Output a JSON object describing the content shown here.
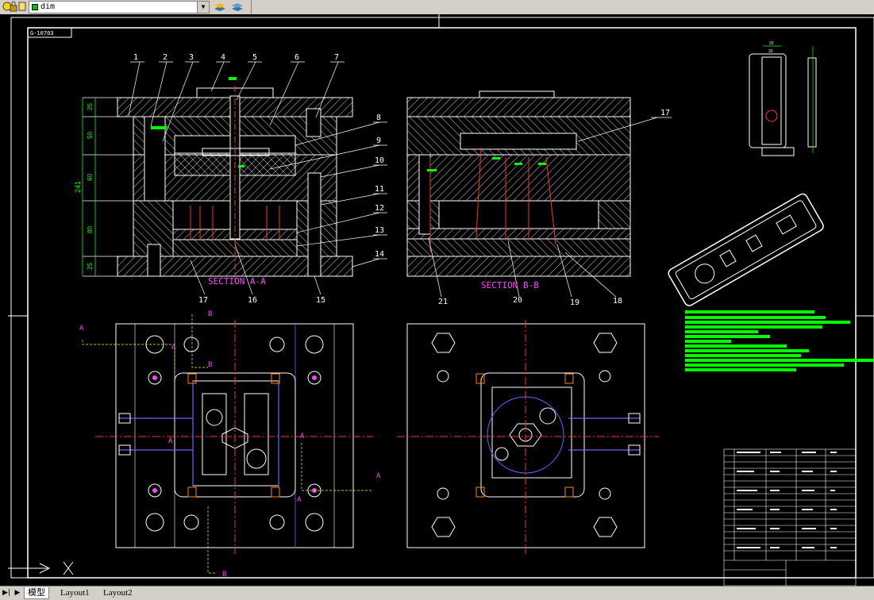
{
  "toolbar": {
    "layer_name": "dim",
    "layer_color": "#00c000",
    "icons": [
      "layer-state-icon",
      "layer-lock-icon",
      "layer-freeze-icon",
      "layer-color-icon",
      "layer-previous-icon",
      "layer-manager-icon"
    ]
  },
  "drawing": {
    "title_block_text": "G-10703",
    "dimensions": [
      "25",
      "50",
      "60",
      "80",
      "25",
      "241"
    ],
    "top_view_dims": [
      "22",
      "32"
    ],
    "part_numbers_left": [
      "1",
      "2",
      "3",
      "4",
      "5",
      "6",
      "7"
    ],
    "part_numbers_right": [
      "8",
      "9",
      "10",
      "11",
      "12",
      "13",
      "14"
    ],
    "part_numbers_bottom_left": [
      "17",
      "16",
      "15"
    ],
    "part_numbers_b": [
      "17"
    ],
    "part_numbers_bottom_right": [
      "21",
      "20",
      "19",
      "18"
    ],
    "section_aa_label": "SECTION A-A",
    "section_bb_label": "SECTION B-B",
    "section_markers": [
      "A",
      "A",
      "A",
      "A",
      "A",
      "A",
      "B",
      "B",
      "B"
    ],
    "axis_x_label": "X",
    "colors": {
      "line": "#ffffff",
      "hatch": "#ffffff",
      "centerline": "#ff3030",
      "dimension": "#00ff00",
      "section_text": "#ff44ff",
      "hidden": "#ffff00",
      "cooling": "#6666ff",
      "highlight": "#ff8800"
    }
  },
  "layout_tabs": {
    "model": "模型",
    "layout1": "Layout1",
    "layout2": "Layout2"
  }
}
